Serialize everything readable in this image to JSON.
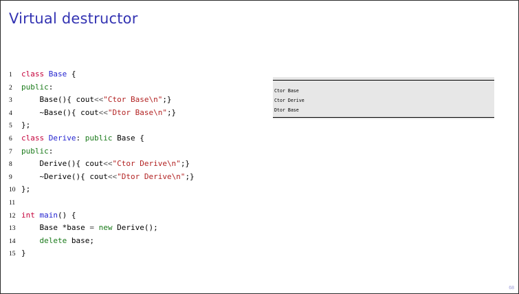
{
  "slide": {
    "title": "Virtual destructor",
    "page_number": "68"
  },
  "code": {
    "lines": [
      {
        "n": "1",
        "parts": [
          {
            "t": "class",
            "c": "ty"
          },
          {
            "t": " "
          },
          {
            "t": "Base",
            "c": "cn"
          },
          {
            "t": " {"
          }
        ]
      },
      {
        "n": "2",
        "parts": [
          {
            "t": "public",
            "c": "kw"
          },
          {
            "t": ":"
          }
        ]
      },
      {
        "n": "3",
        "parts": [
          {
            "t": "    Base(){ cout"
          },
          {
            "t": "<<",
            "c": "op"
          },
          {
            "t": "\"Ctor Base\\n\"",
            "c": "st"
          },
          {
            "t": ";}"
          }
        ]
      },
      {
        "n": "4",
        "parts": [
          {
            "t": "    ~Base(){ cout"
          },
          {
            "t": "<<",
            "c": "op"
          },
          {
            "t": "\"Dtor Base\\n\"",
            "c": "st"
          },
          {
            "t": ";}"
          }
        ]
      },
      {
        "n": "5",
        "parts": [
          {
            "t": "};"
          }
        ]
      },
      {
        "n": "6",
        "parts": [
          {
            "t": "class",
            "c": "ty"
          },
          {
            "t": " "
          },
          {
            "t": "Derive",
            "c": "cn"
          },
          {
            "t": ": "
          },
          {
            "t": "public",
            "c": "kw"
          },
          {
            "t": " Base {"
          }
        ]
      },
      {
        "n": "7",
        "parts": [
          {
            "t": "public",
            "c": "kw"
          },
          {
            "t": ":"
          }
        ]
      },
      {
        "n": "8",
        "parts": [
          {
            "t": "    Derive(){ cout"
          },
          {
            "t": "<<",
            "c": "op"
          },
          {
            "t": "\"Ctor Derive\\n\"",
            "c": "st"
          },
          {
            "t": ";}"
          }
        ]
      },
      {
        "n": "9",
        "parts": [
          {
            "t": "    ~Derive(){ cout"
          },
          {
            "t": "<<",
            "c": "op"
          },
          {
            "t": "\"Dtor Derive\\n\"",
            "c": "st"
          },
          {
            "t": ";}"
          }
        ]
      },
      {
        "n": "10",
        "parts": [
          {
            "t": "};"
          }
        ]
      },
      {
        "n": "11",
        "parts": []
      },
      {
        "n": "12",
        "parts": [
          {
            "t": "int",
            "c": "ty"
          },
          {
            "t": " "
          },
          {
            "t": "main",
            "c": "cn"
          },
          {
            "t": "() {"
          }
        ]
      },
      {
        "n": "13",
        "parts": [
          {
            "t": "    Base *base "
          },
          {
            "t": "=",
            "c": "op"
          },
          {
            "t": " "
          },
          {
            "t": "new",
            "c": "kw"
          },
          {
            "t": " Derive();"
          }
        ]
      },
      {
        "n": "14",
        "parts": [
          {
            "t": "    "
          },
          {
            "t": "delete",
            "c": "kw"
          },
          {
            "t": " base;"
          }
        ]
      },
      {
        "n": "15",
        "parts": [
          {
            "t": "}"
          }
        ]
      }
    ]
  },
  "output": {
    "lines": [
      "Ctor Base",
      "Ctor Derive",
      "Dtor Base"
    ]
  },
  "colors": {
    "title": "#3333b2",
    "keyword": "#1a7a1a",
    "type": "#c4003a",
    "name": "#2323d0",
    "string": "#b22222",
    "output_bg": "#e7e7e7"
  }
}
